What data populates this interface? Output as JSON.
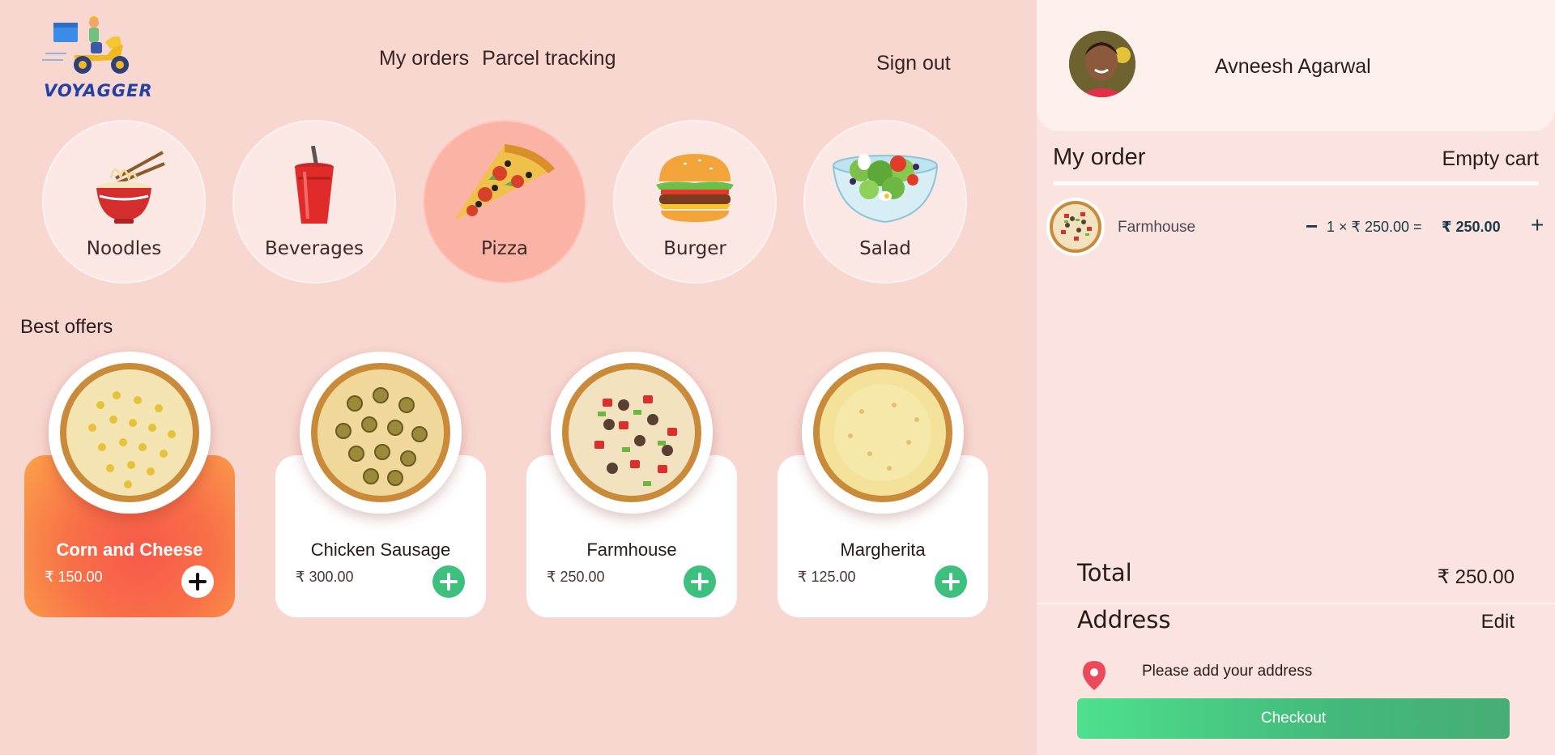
{
  "brand": {
    "name": "VOYAGGER"
  },
  "nav": {
    "my_orders": "My orders",
    "parcel_tracking": "Parcel tracking",
    "sign_out": "Sign out"
  },
  "categories": [
    {
      "label": "Noodles",
      "icon": "noodles-icon",
      "active": false
    },
    {
      "label": "Beverages",
      "icon": "beverage-icon",
      "active": false
    },
    {
      "label": "Pizza",
      "icon": "pizza-icon",
      "active": true
    },
    {
      "label": "Burger",
      "icon": "burger-icon",
      "active": false
    },
    {
      "label": "Salad",
      "icon": "salad-icon",
      "active": false
    }
  ],
  "best_offers": {
    "title": "Best offers",
    "items": [
      {
        "name": "Corn and Cheese",
        "price": "₹ 150.00",
        "active": true
      },
      {
        "name": "Chicken Sausage",
        "price": "₹ 300.00",
        "active": false
      },
      {
        "name": "Farmhouse",
        "price": "₹ 250.00",
        "active": false
      },
      {
        "name": "Margherita",
        "price": "₹ 125.00",
        "active": false
      }
    ]
  },
  "user": {
    "name": "Avneesh Agarwal"
  },
  "order": {
    "title": "My order",
    "empty_cart": "Empty cart",
    "items": [
      {
        "name": "Farmhouse",
        "minus": "−",
        "expr": "1 × ₹ 250.00 =",
        "line_total": "₹ 250.00",
        "plus": "+"
      }
    ],
    "total_label": "Total",
    "total_value": "₹ 250.00",
    "address_label": "Address",
    "edit": "Edit",
    "address_text": "Please add your address",
    "checkout": "Checkout"
  },
  "colors": {
    "background": "#f9d7d1",
    "sidebar": "#fbe3df",
    "accent_green": "#3dbf7e",
    "active_category": "#fbb3a6"
  }
}
